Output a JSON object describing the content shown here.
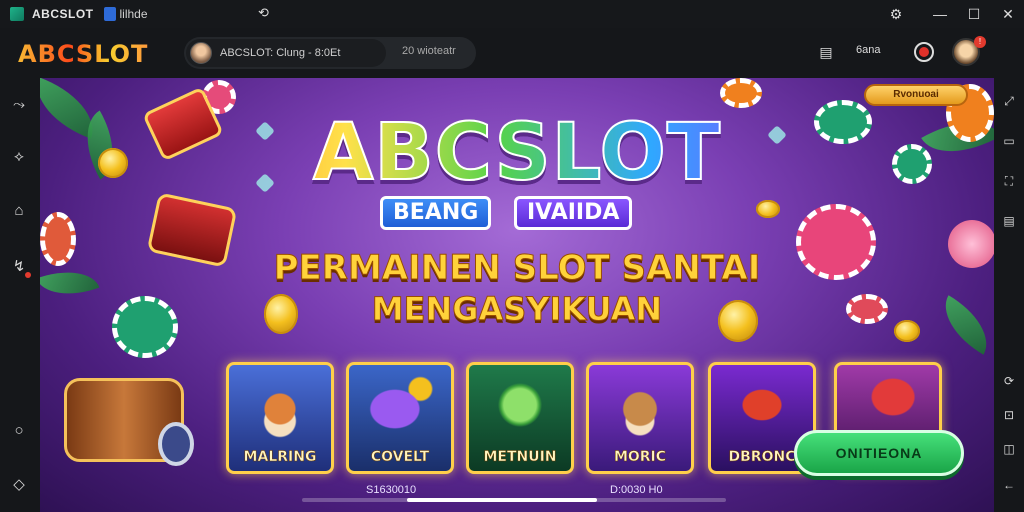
{
  "window": {
    "title": "ABCSLOT",
    "subtitle": "lilhde",
    "controls": {
      "settings_icon": "gear-icon",
      "minimize": "—",
      "maximize": "☐",
      "close": "✕"
    }
  },
  "header": {
    "brand": "ABCSLOT",
    "session_text": "ABCSLOT: Clung - 8:0Et",
    "viewers": "20 wioteatr",
    "label": "6ana"
  },
  "banner": {
    "top_pill": "Rvonuoai",
    "title": "ABCSLOT",
    "ribbon_left": "BEANG",
    "ribbon_right": "IVAIIDA",
    "tagline_1": "PERMAINEN SLOT SANTAI",
    "tagline_2": "MENGASYIKUAN",
    "games": [
      {
        "label": "MALRING"
      },
      {
        "label": "COVELT"
      },
      {
        "label": "METNUIN"
      },
      {
        "label": "MORIC"
      },
      {
        "label": "DBRONC"
      }
    ],
    "cta": "ONITIEONA",
    "stat_left": "S1630010",
    "stat_right": "D:0030 H0",
    "scroll_position": 0.45
  },
  "colors": {
    "accent": "#1aa548",
    "brand_gold": "#ffd23a",
    "banner_purple": "#7a3fb3"
  }
}
